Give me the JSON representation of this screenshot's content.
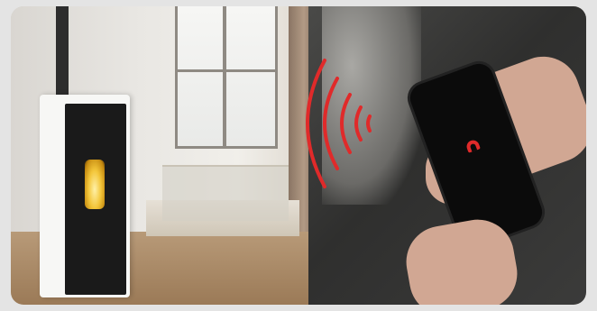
{
  "image": {
    "subject": "pellet-stove-smartphone-control",
    "accent_color": "#e02a2a"
  },
  "phone_screen": {
    "logo_text": "",
    "logo_mark": "red-stove-logo-icon"
  },
  "signal": {
    "icon": "wireless-signal-arcs-icon",
    "color": "#e02a2a"
  }
}
